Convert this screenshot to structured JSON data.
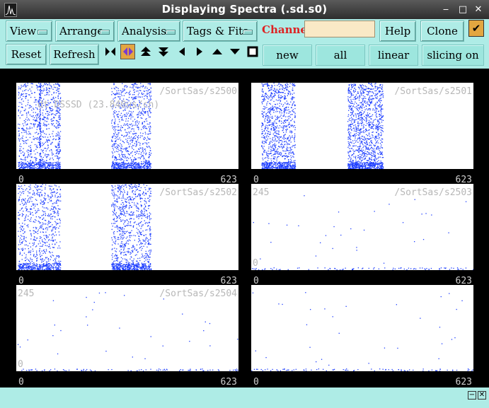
{
  "window": {
    "title": "Displaying Spectra (.sd.s0)",
    "controls": {
      "minimize": "‒",
      "maximize": "□",
      "close": "✕"
    }
  },
  "menubar": {
    "view": "View",
    "arrange": "Arrange",
    "analysis": "Analysis",
    "tags_fits": "Tags & Fits",
    "channel_label": "Channel:",
    "channel_value": "",
    "help": "Help",
    "clone": "Clone",
    "clone_checked": true
  },
  "toolbar": {
    "reset": "Reset",
    "refresh": "Refresh",
    "icons": [
      "zoom-in-icon",
      "zoom-out-icon",
      "expand-up-icon",
      "expand-down-icon",
      "left-icon",
      "right-icon",
      "up-icon",
      "down-icon",
      "stop-icon"
    ],
    "new": "new",
    "all": "all",
    "linear": "linear",
    "slicing": "slicing on"
  },
  "plots": [
    {
      "label": "/SortSas/s2500",
      "label2": "dt DSSSD (23.840us/ch)",
      "ymax": "",
      "ymin": "",
      "xmin": "0",
      "xmax": "623",
      "density": "dense"
    },
    {
      "label": "/SortSas/s2501",
      "label2": "",
      "ymax": "",
      "ymin": "",
      "xmin": "0",
      "xmax": "623",
      "density": "dense"
    },
    {
      "label": "/SortSas/s2502",
      "label2": "",
      "ymax": "",
      "ymin": "",
      "xmin": "0",
      "xmax": "623",
      "density": "dense"
    },
    {
      "label": "/SortSas/s2503",
      "label2": "",
      "ymax": "245",
      "ymin": "0",
      "xmin": "0",
      "xmax": "623",
      "density": "sparse"
    },
    {
      "label": "/SortSas/s2504",
      "label2": "",
      "ymax": "245",
      "ymin": "0",
      "xmin": "0",
      "xmax": "623",
      "density": "sparse"
    },
    {
      "label": "",
      "label2": "",
      "ymax": "",
      "ymin": "",
      "xmin": "0",
      "xmax": "623",
      "density": "sparse"
    }
  ],
  "colors": {
    "panel": "#aeece6",
    "accent": "#e3a640",
    "channel": "#dd2222",
    "plot_points": "#1f3fff"
  }
}
